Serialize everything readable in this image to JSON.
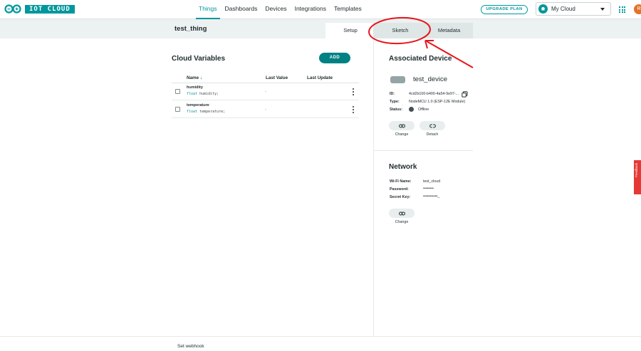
{
  "header": {
    "brand": "IOT CLOUD",
    "nav": [
      "Things",
      "Dashboards",
      "Devices",
      "Integrations",
      "Templates"
    ],
    "nav_active": "Things",
    "upgrade_label": "UPGRADE PLAN",
    "space_label": "My Cloud",
    "avatar_initial": "R"
  },
  "subheader": {
    "thing_name": "test_thing",
    "tabs": [
      "Setup",
      "Sketch",
      "Metadata"
    ],
    "active_tab": "Setup"
  },
  "variables": {
    "title": "Cloud Variables",
    "add_label": "ADD",
    "columns": [
      "Name ↓",
      "Last Value",
      "Last Update"
    ],
    "rows": [
      {
        "name": "humidity",
        "type": "float",
        "decl": " humidity;",
        "value": "-"
      },
      {
        "name": "temperature",
        "type": "float",
        "decl": " temperature;",
        "value": "-"
      }
    ]
  },
  "device": {
    "title": "Associated Device",
    "name": "test_device",
    "id_label": "ID:",
    "id_value": "4cd2b100-b400-4a54-9e97-...",
    "type_label": "Type:",
    "type_value": "NodeMCU 1.0 (ESP-12E Module)",
    "status_label": "Status:",
    "status_value": "Offline",
    "change_label": "Change",
    "detach_label": "Detach"
  },
  "network": {
    "title": "Network",
    "wifi_label": "Wi-Fi Name:",
    "wifi_value": "test_cloud",
    "password_label": "Password:",
    "password_value": "••••••••",
    "secret_label": "Secret Key:",
    "secret_value": "•••••••••••_",
    "change_label": "Change"
  },
  "footer": {
    "webhook_label": "Set webhook"
  },
  "feedback_label": "Feedback",
  "colors": {
    "accent": "#00979d",
    "annotation": "#e8141a",
    "feedback": "#e53935"
  }
}
